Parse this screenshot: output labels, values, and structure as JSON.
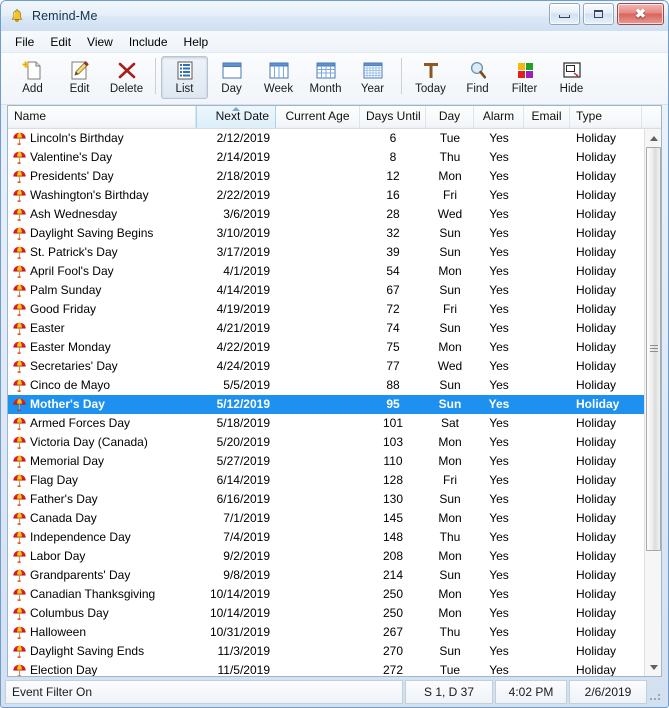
{
  "window": {
    "title": "Remind-Me",
    "icon": "bell-icon",
    "minimize_label": "Minimize",
    "maximize_label": "Maximize",
    "close_label": "Close"
  },
  "menu": {
    "items": [
      {
        "label": "File"
      },
      {
        "label": "Edit"
      },
      {
        "label": "View"
      },
      {
        "label": "Include"
      },
      {
        "label": "Help"
      }
    ]
  },
  "toolbar": {
    "buttons": [
      {
        "label": "Add",
        "icon": "add-page-icon",
        "active": false
      },
      {
        "label": "Edit",
        "icon": "edit-pencil-icon",
        "active": false
      },
      {
        "label": "Delete",
        "icon": "delete-x-icon",
        "active": false
      },
      {
        "label": "List",
        "icon": "list-view-icon",
        "active": true
      },
      {
        "label": "Day",
        "icon": "day-view-icon",
        "active": false
      },
      {
        "label": "Week",
        "icon": "week-view-icon",
        "active": false
      },
      {
        "label": "Month",
        "icon": "month-view-icon",
        "active": false
      },
      {
        "label": "Year",
        "icon": "year-view-icon",
        "active": false
      },
      {
        "label": "Today",
        "icon": "today-t-icon",
        "active": false
      },
      {
        "label": "Find",
        "icon": "magnifier-icon",
        "active": false
      },
      {
        "label": "Filter",
        "icon": "filter-squares-icon",
        "active": false
      },
      {
        "label": "Hide",
        "icon": "hide-window-icon",
        "active": false
      }
    ]
  },
  "list": {
    "sort_column": "Next Date",
    "sort_direction": "ascending",
    "selected_index": 14,
    "columns": [
      {
        "key": "name",
        "label": "Name",
        "align": "left"
      },
      {
        "key": "date",
        "label": "Next Date",
        "align": "right"
      },
      {
        "key": "age",
        "label": "Current Age",
        "align": "center"
      },
      {
        "key": "days",
        "label": "Days Until",
        "align": "right"
      },
      {
        "key": "day",
        "label": "Day",
        "align": "center"
      },
      {
        "key": "alarm",
        "label": "Alarm",
        "align": "center"
      },
      {
        "key": "email",
        "label": "Email",
        "align": "center"
      },
      {
        "key": "type",
        "label": "Type",
        "align": "left"
      }
    ],
    "row_icon": "beach-umbrella-icon",
    "rows": [
      {
        "name": "Lincoln's Birthday",
        "date": "2/12/2019",
        "age": "",
        "days": "6",
        "day": "Tue",
        "alarm": "Yes",
        "email": "",
        "type": "Holiday"
      },
      {
        "name": "Valentine's Day",
        "date": "2/14/2019",
        "age": "",
        "days": "8",
        "day": "Thu",
        "alarm": "Yes",
        "email": "",
        "type": "Holiday"
      },
      {
        "name": "Presidents' Day",
        "date": "2/18/2019",
        "age": "",
        "days": "12",
        "day": "Mon",
        "alarm": "Yes",
        "email": "",
        "type": "Holiday"
      },
      {
        "name": "Washington's Birthday",
        "date": "2/22/2019",
        "age": "",
        "days": "16",
        "day": "Fri",
        "alarm": "Yes",
        "email": "",
        "type": "Holiday"
      },
      {
        "name": "Ash Wednesday",
        "date": "3/6/2019",
        "age": "",
        "days": "28",
        "day": "Wed",
        "alarm": "Yes",
        "email": "",
        "type": "Holiday"
      },
      {
        "name": "Daylight Saving Begins",
        "date": "3/10/2019",
        "age": "",
        "days": "32",
        "day": "Sun",
        "alarm": "Yes",
        "email": "",
        "type": "Holiday"
      },
      {
        "name": "St. Patrick's Day",
        "date": "3/17/2019",
        "age": "",
        "days": "39",
        "day": "Sun",
        "alarm": "Yes",
        "email": "",
        "type": "Holiday"
      },
      {
        "name": "April Fool's Day",
        "date": "4/1/2019",
        "age": "",
        "days": "54",
        "day": "Mon",
        "alarm": "Yes",
        "email": "",
        "type": "Holiday"
      },
      {
        "name": "Palm Sunday",
        "date": "4/14/2019",
        "age": "",
        "days": "67",
        "day": "Sun",
        "alarm": "Yes",
        "email": "",
        "type": "Holiday"
      },
      {
        "name": "Good Friday",
        "date": "4/19/2019",
        "age": "",
        "days": "72",
        "day": "Fri",
        "alarm": "Yes",
        "email": "",
        "type": "Holiday"
      },
      {
        "name": "Easter",
        "date": "4/21/2019",
        "age": "",
        "days": "74",
        "day": "Sun",
        "alarm": "Yes",
        "email": "",
        "type": "Holiday"
      },
      {
        "name": "Easter Monday",
        "date": "4/22/2019",
        "age": "",
        "days": "75",
        "day": "Mon",
        "alarm": "Yes",
        "email": "",
        "type": "Holiday"
      },
      {
        "name": "Secretaries' Day",
        "date": "4/24/2019",
        "age": "",
        "days": "77",
        "day": "Wed",
        "alarm": "Yes",
        "email": "",
        "type": "Holiday"
      },
      {
        "name": "Cinco de Mayo",
        "date": "5/5/2019",
        "age": "",
        "days": "88",
        "day": "Sun",
        "alarm": "Yes",
        "email": "",
        "type": "Holiday"
      },
      {
        "name": "Mother's Day",
        "date": "5/12/2019",
        "age": "",
        "days": "95",
        "day": "Sun",
        "alarm": "Yes",
        "email": "",
        "type": "Holiday"
      },
      {
        "name": "Armed Forces Day",
        "date": "5/18/2019",
        "age": "",
        "days": "101",
        "day": "Sat",
        "alarm": "Yes",
        "email": "",
        "type": "Holiday"
      },
      {
        "name": "Victoria Day (Canada)",
        "date": "5/20/2019",
        "age": "",
        "days": "103",
        "day": "Mon",
        "alarm": "Yes",
        "email": "",
        "type": "Holiday"
      },
      {
        "name": "Memorial Day",
        "date": "5/27/2019",
        "age": "",
        "days": "110",
        "day": "Mon",
        "alarm": "Yes",
        "email": "",
        "type": "Holiday"
      },
      {
        "name": "Flag Day",
        "date": "6/14/2019",
        "age": "",
        "days": "128",
        "day": "Fri",
        "alarm": "Yes",
        "email": "",
        "type": "Holiday"
      },
      {
        "name": "Father's Day",
        "date": "6/16/2019",
        "age": "",
        "days": "130",
        "day": "Sun",
        "alarm": "Yes",
        "email": "",
        "type": "Holiday"
      },
      {
        "name": "Canada Day",
        "date": "7/1/2019",
        "age": "",
        "days": "145",
        "day": "Mon",
        "alarm": "Yes",
        "email": "",
        "type": "Holiday"
      },
      {
        "name": "Independence Day",
        "date": "7/4/2019",
        "age": "",
        "days": "148",
        "day": "Thu",
        "alarm": "Yes",
        "email": "",
        "type": "Holiday"
      },
      {
        "name": "Labor Day",
        "date": "9/2/2019",
        "age": "",
        "days": "208",
        "day": "Mon",
        "alarm": "Yes",
        "email": "",
        "type": "Holiday"
      },
      {
        "name": "Grandparents' Day",
        "date": "9/8/2019",
        "age": "",
        "days": "214",
        "day": "Sun",
        "alarm": "Yes",
        "email": "",
        "type": "Holiday"
      },
      {
        "name": "Canadian Thanksgiving",
        "date": "10/14/2019",
        "age": "",
        "days": "250",
        "day": "Mon",
        "alarm": "Yes",
        "email": "",
        "type": "Holiday"
      },
      {
        "name": "Columbus Day",
        "date": "10/14/2019",
        "age": "",
        "days": "250",
        "day": "Mon",
        "alarm": "Yes",
        "email": "",
        "type": "Holiday"
      },
      {
        "name": "Halloween",
        "date": "10/31/2019",
        "age": "",
        "days": "267",
        "day": "Thu",
        "alarm": "Yes",
        "email": "",
        "type": "Holiday"
      },
      {
        "name": "Daylight Saving Ends",
        "date": "11/3/2019",
        "age": "",
        "days": "270",
        "day": "Sun",
        "alarm": "Yes",
        "email": "",
        "type": "Holiday"
      },
      {
        "name": "Election Day",
        "date": "11/5/2019",
        "age": "",
        "days": "272",
        "day": "Tue",
        "alarm": "Yes",
        "email": "",
        "type": "Holiday"
      }
    ]
  },
  "statusbar": {
    "message": "Event Filter On",
    "counts": "S 1, D 37",
    "time": "4:02 PM",
    "date": "2/6/2019"
  },
  "colors": {
    "selection_blue": "#1e90ef",
    "sorted_header": "#ddeffa",
    "window_border": "#6f9ccb"
  }
}
